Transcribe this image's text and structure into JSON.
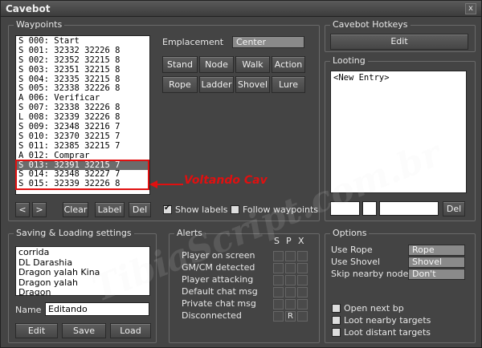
{
  "window": {
    "title": "Cavebot",
    "close_glyph": "x"
  },
  "waypoints": {
    "group_label": "Waypoints",
    "items": [
      "S 000: Start",
      "S 001: 32332 32226 8",
      "S 002: 32352 32215 8",
      "S 003: 32351 32215 8",
      "S 004: 32335 32215 8",
      "S 005: 32338 32226 8",
      "A 006: Verificar",
      "S 007: 32338 32226 8",
      "L 008: 32339 32226 8",
      "S 009: 32348 32216 7",
      "S 010: 32370 32215 7",
      "S 011: 32385 32215 7",
      "A 012: Comprar",
      "S 013: 32391 32215 7",
      "S 014: 32348 32227 7",
      "S 015: 32339 32226 8"
    ],
    "selected_index": 13,
    "emplacement_label": "Emplacement",
    "emplacement_value": "Center",
    "buttons": {
      "stand": "Stand",
      "node": "Node",
      "walk": "Walk",
      "action": "Action",
      "rope": "Rope",
      "ladder": "Ladder",
      "shovel": "Shovel",
      "lure": "Lure"
    },
    "nav_prev": "<",
    "nav_next": ">",
    "clear": "Clear",
    "label": "Label",
    "del": "Del",
    "show_labels": "Show labels",
    "show_labels_checked": true,
    "follow_waypoints": "Follow waypoints",
    "follow_waypoints_checked": false
  },
  "annotation": {
    "text": "Voltando Cav",
    "color": "#e01010"
  },
  "hotkeys": {
    "group_label": "Cavebot Hotkeys",
    "edit": "Edit"
  },
  "looting": {
    "group_label": "Looting",
    "entry": "<New Entry>",
    "del": "Del"
  },
  "saving": {
    "group_label": "Saving & Loading settings",
    "items": [
      "corrida",
      "DL Darashia",
      "Dragon yalah Kina",
      "Dragon yalah",
      "Dragon"
    ],
    "name_label": "Name",
    "name_value": "Editando",
    "edit": "Edit",
    "save": "Save",
    "load": "Load"
  },
  "alerts": {
    "group_label": "Alerts",
    "headers": [
      "S",
      "P",
      "X"
    ],
    "rows": [
      {
        "label": "Player on screen",
        "marks": [
          "",
          "",
          ""
        ]
      },
      {
        "label": "GM/CM detected",
        "marks": [
          "",
          "",
          ""
        ]
      },
      {
        "label": "Player attacking",
        "marks": [
          "",
          "",
          ""
        ]
      },
      {
        "label": "Default chat msg",
        "marks": [
          "",
          "",
          ""
        ]
      },
      {
        "label": "Private chat msg",
        "marks": [
          "",
          "",
          ""
        ]
      },
      {
        "label": "Disconnected",
        "marks": [
          "",
          "R",
          ""
        ]
      }
    ]
  },
  "options": {
    "group_label": "Options",
    "use_rope_label": "Use Rope",
    "use_rope_value": "Rope",
    "use_shovel_label": "Use Shovel",
    "use_shovel_value": "Shovel",
    "skip_label": "Skip nearby nodes",
    "skip_value": "Don't",
    "open_next_bp": "Open next bp",
    "loot_nearby": "Loot nearby targets",
    "loot_distant": "Loot distant targets"
  },
  "watermark": "TibiaScript.com.br",
  "colors": {
    "accent_red": "#e01010",
    "panel_bg": "#444444",
    "field_bg": "#8a8a8a"
  }
}
